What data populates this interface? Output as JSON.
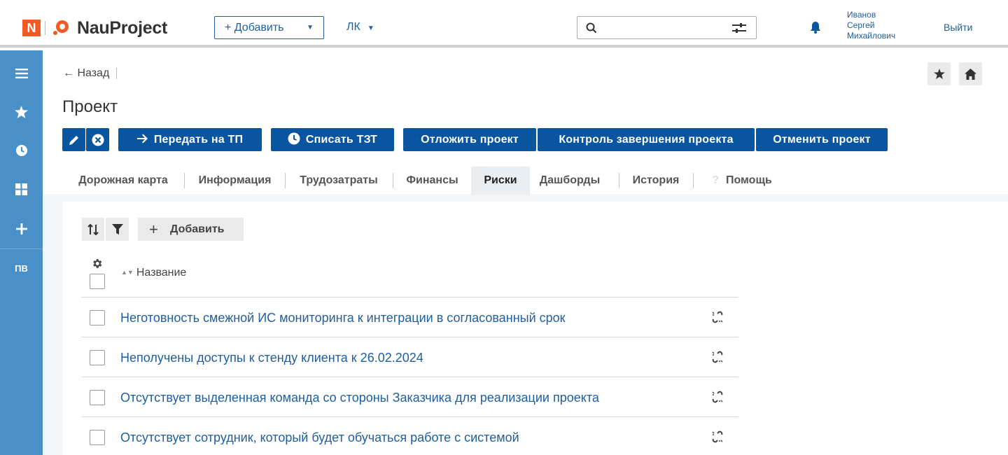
{
  "header": {
    "logo_letter": "N",
    "brand": "NauProject",
    "add_button": "+ Добавить",
    "lk_menu": "ЛК",
    "search_placeholder": "",
    "user_lines": [
      "Иванов",
      "Сергей",
      "Михайлович"
    ],
    "logout": "Выйти",
    "brand_color": "#f15a22",
    "accent_color": "#1f5fa0"
  },
  "sidebar": {
    "items": [
      {
        "icon": "menu-icon"
      },
      {
        "icon": "star-icon"
      },
      {
        "icon": "clock-icon"
      },
      {
        "icon": "grid-icon"
      },
      {
        "icon": "plus-icon"
      }
    ],
    "user_initials": "ПВ",
    "background": "#4a90c8"
  },
  "page": {
    "back": "← Назад",
    "title": "Проект"
  },
  "actions": {
    "transfer": "Передать на ТП",
    "write_off": "Списать ТЗТ",
    "postpone": "Отложить проект",
    "control": "Контроль завершения проекта",
    "cancel": "Отменить проект",
    "button_color": "#0a55a0"
  },
  "tabs": [
    {
      "label": "Дорожная карта"
    },
    {
      "label": "Информация"
    },
    {
      "label": "Трудозатраты"
    },
    {
      "label": "Финансы"
    },
    {
      "label": "Риски",
      "active": true
    },
    {
      "label": "Дашборды"
    },
    {
      "label": "История"
    },
    {
      "label": "Помощь"
    }
  ],
  "toolbar": {
    "add": "Добавить"
  },
  "table": {
    "column_name": "Название",
    "rows": [
      {
        "name": "Неготовность смежной ИС мониторинга к интеграции в согласованный срок"
      },
      {
        "name": "Неполучены доступы к стенду клиента к 26.02.2024"
      },
      {
        "name": "Отсутствует выделенная команда со стороны Заказчика для реализации проекта"
      },
      {
        "name": "Отсутствует сотрудник, который будет обучаться работе с системой"
      }
    ]
  }
}
